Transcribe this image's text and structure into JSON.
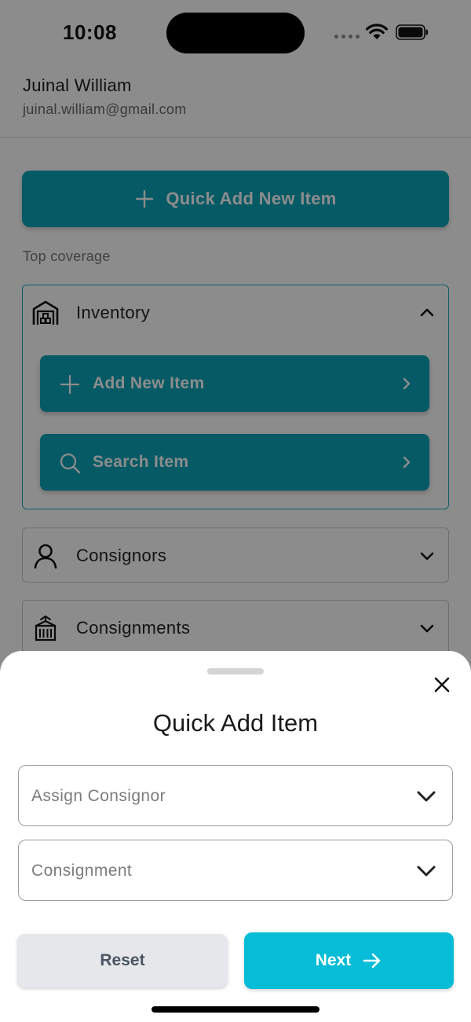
{
  "status_bar": {
    "time": "10:08",
    "icons": [
      "signal-icon",
      "wifi-icon",
      "battery-icon"
    ]
  },
  "header": {
    "user_name": "Juinal William",
    "user_email": "juinal.william@gmail.com"
  },
  "main": {
    "quick_add_label": "Quick Add New Item",
    "section_label": "Top coverage",
    "accordions": [
      {
        "title": "Inventory",
        "icon": "warehouse-icon",
        "expanded": true,
        "actions": [
          {
            "label": "Add New Item",
            "icon": "plus-icon"
          },
          {
            "label": "Search Item",
            "icon": "search-icon"
          }
        ]
      },
      {
        "title": "Consignors",
        "icon": "person-icon",
        "expanded": false
      },
      {
        "title": "Consignments",
        "icon": "container-icon",
        "expanded": false
      }
    ]
  },
  "sheet": {
    "title": "Quick Add Item",
    "fields": [
      {
        "placeholder": "Assign Consignor"
      },
      {
        "placeholder": "Consignment"
      }
    ],
    "reset_label": "Reset",
    "next_label": "Next"
  },
  "colors": {
    "accent": "#0aa4b8",
    "next_button": "#06bcd6",
    "reset_button": "#e5e7eb",
    "overlay": "rgba(0,0,0,0.45)"
  }
}
